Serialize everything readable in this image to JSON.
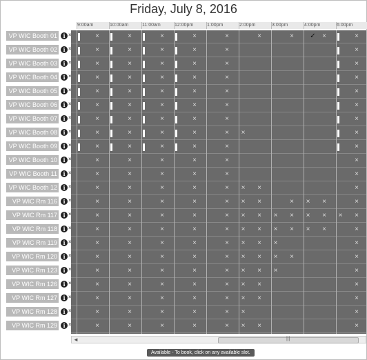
{
  "title": "Friday, July 8, 2016",
  "time_labels": [
    "9:00am",
    "10:00am",
    "11:00am",
    "12:00pm",
    "1:00pm",
    "2:00pm",
    "3:00pm",
    "4:00pm",
    "6:00pm"
  ],
  "rooms": [
    "VP WIC Booth 01",
    "VP WIC Booth 02",
    "VP WIC Booth 03",
    "VP WIC Booth 04",
    "VP WIC Booth 05",
    "VP WIC Booth 06",
    "VP WIC Booth 07",
    "VP WIC Booth 08",
    "VP WIC Booth 09",
    "VP WIC Booth 10",
    "VP WIC Booth 11",
    "VP WIC Booth 12",
    "VP WIC Rm 116",
    "VP WIC Rm 117",
    "VP WIC Rm 118",
    "VP WIC Rm 119",
    "VP WIC Rm 120",
    "VP WIC Rm 123",
    "VP WIC Rm 126",
    "VP WIC Rm 127",
    "VP WIC Rm 128",
    "VP WIC Rm 129"
  ],
  "info_icon": "info-icon",
  "unavailable_mark": "×",
  "selected_mark": "✓",
  "scroll": {
    "left_arrow": "◄",
    "grip": "|||"
  },
  "status_text": "Available - To book, click on any available slot.",
  "colors": {
    "booked": "#6a6a6a",
    "room_label": "#b9b9b9"
  }
}
